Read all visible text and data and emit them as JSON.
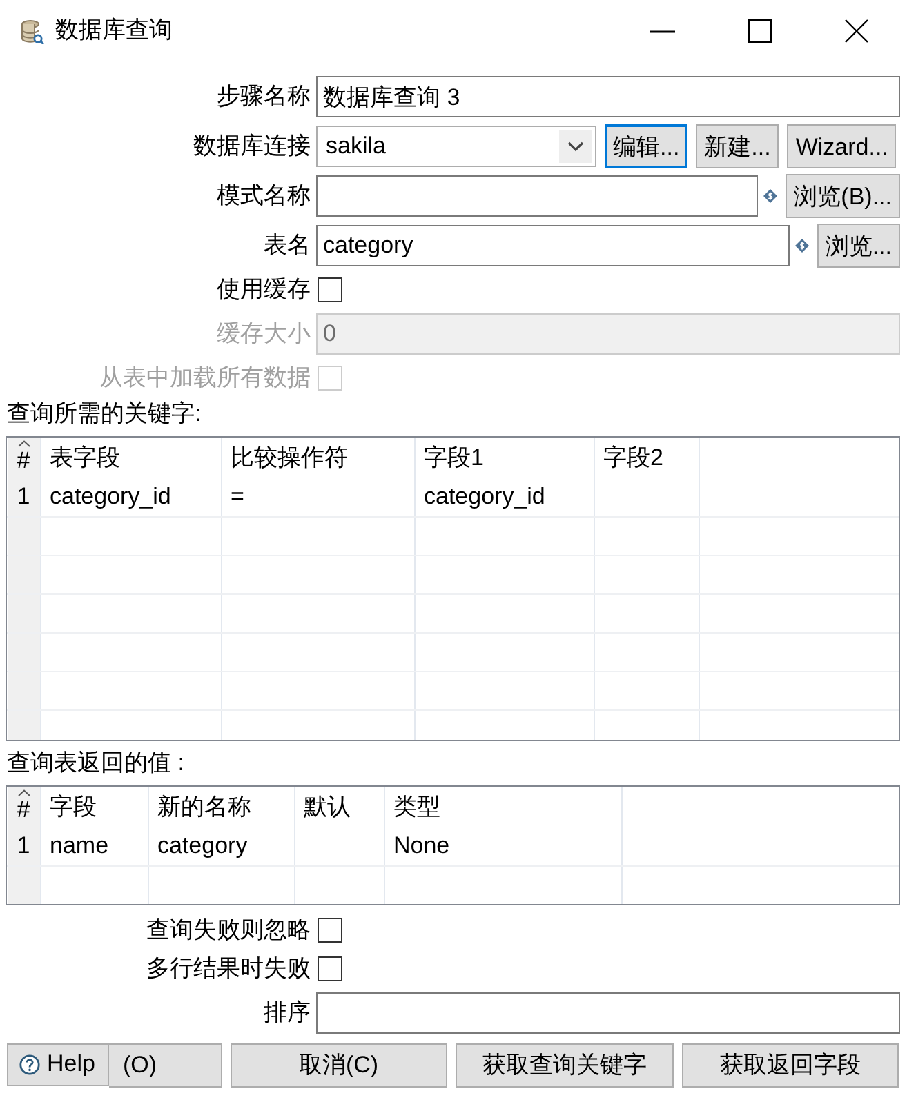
{
  "window": {
    "title": "数据库查询"
  },
  "form": {
    "fields": [
      {
        "kind": "text",
        "label": "步骤名称",
        "value": "数据库查询 3",
        "variable": false,
        "disabled": false
      },
      {
        "kind": "select",
        "label": "数据库连接",
        "value": "sakila",
        "disabled": false,
        "buttons": [
          {
            "label": "编辑...",
            "focused": true
          },
          {
            "label": "新建...",
            "focused": false
          },
          {
            "label": "Wizard...",
            "focused": false
          }
        ]
      },
      {
        "kind": "text",
        "label": "模式名称",
        "variable": true,
        "disabled": false,
        "buttons": [
          {
            "label": "浏览(B)...",
            "focused": false
          }
        ]
      },
      {
        "kind": "text",
        "label": "表名",
        "value": "category",
        "variable": true,
        "disabled": false,
        "buttons": [
          {
            "label": "浏览...",
            "focused": false
          }
        ]
      },
      {
        "kind": "checkbox",
        "label": "使用缓存",
        "checked": false,
        "disabled": false
      },
      {
        "kind": "text",
        "label": "缓存大小",
        "value": "0",
        "variable": false,
        "disabled": true
      },
      {
        "kind": "checkbox",
        "label": "从表中加载所有数据",
        "checked": false,
        "disabled": true
      }
    ]
  },
  "keys": {
    "title": "查询所需的关键字:",
    "columns": [
      {
        "label": "#",
        "sorted": true
      },
      {
        "label": "表字段",
        "sorted": false
      },
      {
        "label": "比较操作符",
        "sorted": false
      },
      {
        "label": "字段1",
        "sorted": false
      },
      {
        "label": "字段2",
        "sorted": false
      }
    ],
    "rows": [
      [
        "1",
        "category_id",
        "=",
        "category_id"
      ]
    ]
  },
  "returns": {
    "title": "查询表返回的值 :",
    "columns": [
      {
        "label": "#",
        "sorted": true
      },
      {
        "label": "字段",
        "sorted": false
      },
      {
        "label": "新的名称",
        "sorted": false
      },
      {
        "label": "默认",
        "sorted": false
      },
      {
        "label": "类型",
        "sorted": false
      }
    ],
    "rows": [
      [
        "1",
        "name",
        "category",
        "",
        "None"
      ]
    ]
  },
  "options": [
    {
      "label": "查询失败则忽略",
      "checked": false
    },
    {
      "label": "多行结果时失败",
      "checked": false
    }
  ],
  "order": {
    "label": "排序"
  },
  "help": {
    "label": "Help"
  },
  "buttons": [
    {
      "label": "(O)",
      "kind": "covered"
    },
    {
      "label": "取消(C)",
      "kind": "plain"
    },
    {
      "label": "获取查询关键字",
      "kind": "plain"
    },
    {
      "label": "获取返回字段",
      "kind": "plain"
    }
  ]
}
